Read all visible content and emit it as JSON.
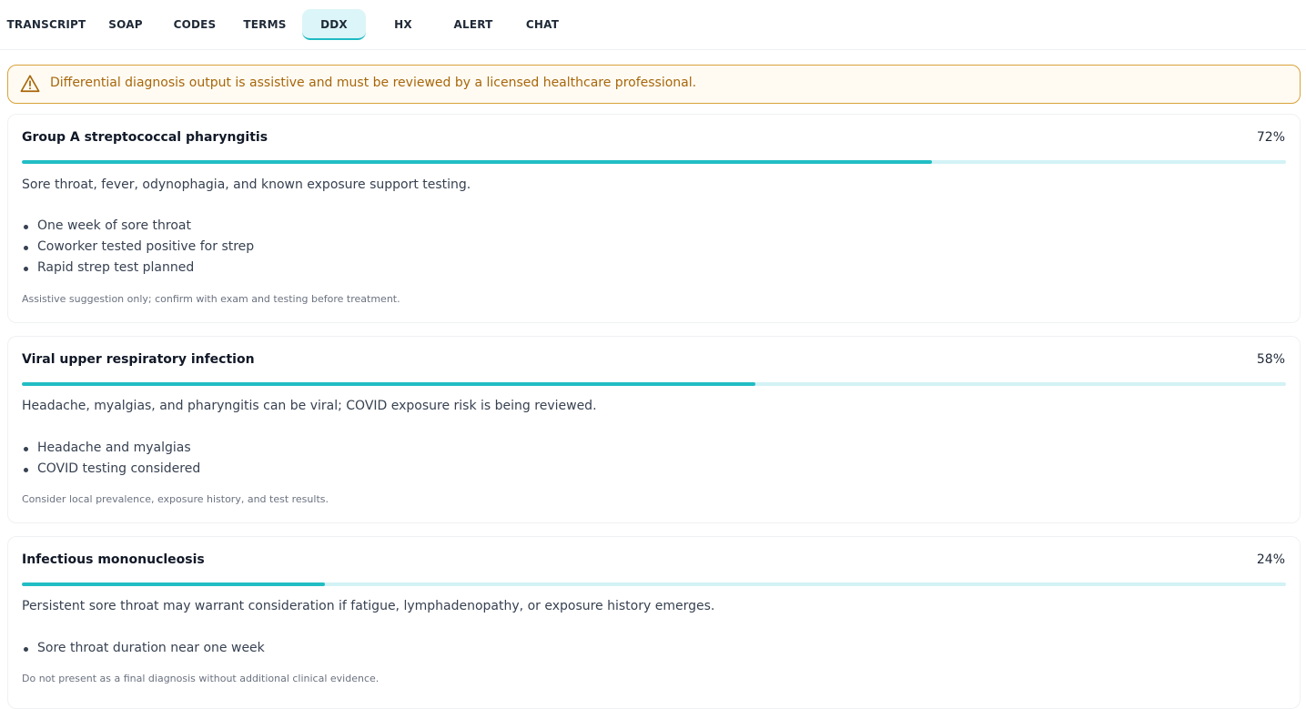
{
  "tabs": [
    {
      "label": "TRANSCRIPT",
      "active": false
    },
    {
      "label": "SOAP",
      "active": false
    },
    {
      "label": "CODES",
      "active": false
    },
    {
      "label": "TERMS",
      "active": false
    },
    {
      "label": "DDX",
      "active": true
    },
    {
      "label": "HX",
      "active": false
    },
    {
      "label": "ALERT",
      "active": false
    },
    {
      "label": "CHAT",
      "active": false
    }
  ],
  "alert": {
    "icon": "warning-triangle-icon",
    "text": "Differential diagnosis output is assistive and must be reviewed by a licensed healthcare professional.",
    "color": "#a7670a"
  },
  "colors": {
    "accent": "#22bdc4",
    "track": "#d3f2f5",
    "alert_border": "#d9a23a"
  },
  "diagnoses": [
    {
      "title": "Group A streptococcal pharyngitis",
      "percent_label": "72%",
      "probability": 0.72,
      "summary": "Sore throat, fever, odynophagia, and known exposure support testing.",
      "evidence": [
        "One week of sore throat",
        "Coworker tested positive for strep",
        "Rapid strep test planned"
      ],
      "note": "Assistive suggestion only; confirm with exam and testing before treatment."
    },
    {
      "title": "Viral upper respiratory infection",
      "percent_label": "58%",
      "probability": 0.58,
      "summary": "Headache, myalgias, and pharyngitis can be viral; COVID exposure risk is being reviewed.",
      "evidence": [
        "Headache and myalgias",
        "COVID testing considered"
      ],
      "note": "Consider local prevalence, exposure history, and test results."
    },
    {
      "title": "Infectious mononucleosis",
      "percent_label": "24%",
      "probability": 0.24,
      "summary": "Persistent sore throat may warrant consideration if fatigue, lymphadenopathy, or exposure history emerges.",
      "evidence": [
        "Sore throat duration near one week"
      ],
      "note": "Do not present as a final diagnosis without additional clinical evidence."
    }
  ]
}
